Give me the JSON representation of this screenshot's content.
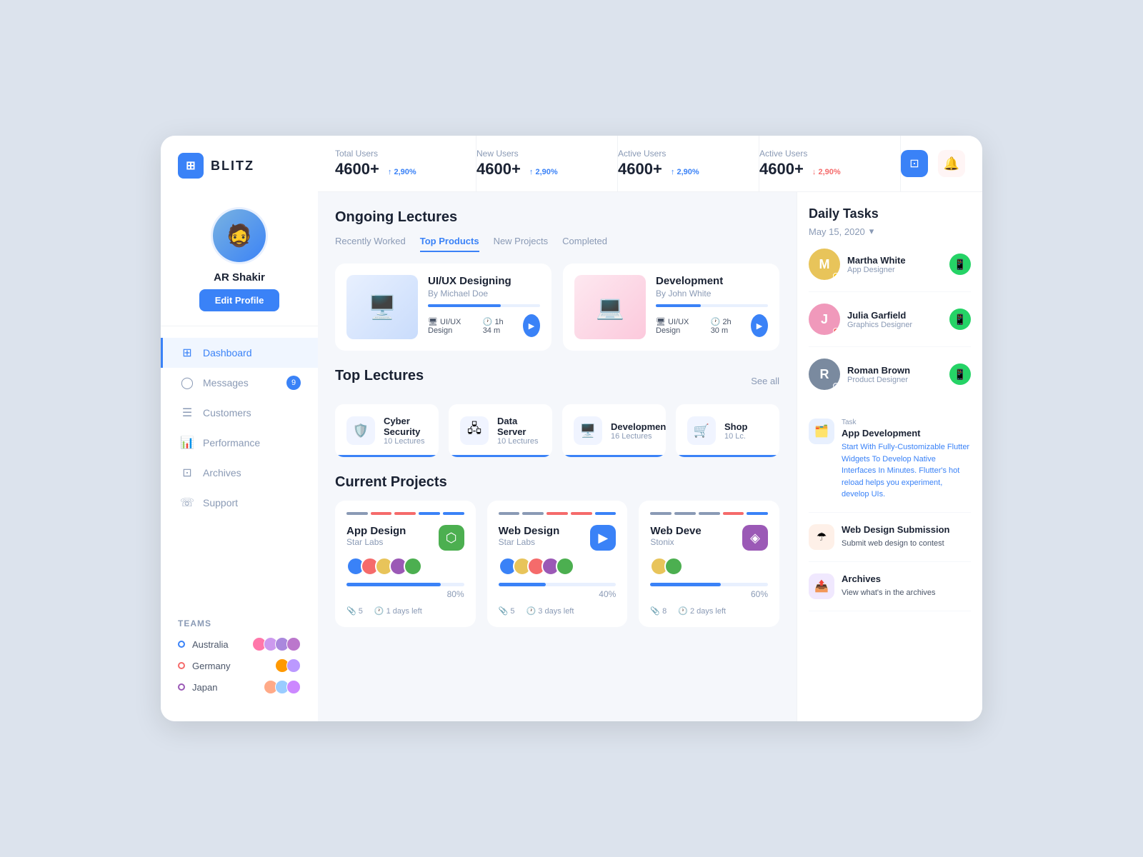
{
  "logo": {
    "icon": "⊞",
    "text": "BLITZ"
  },
  "profile": {
    "name": "AR Shakir",
    "edit_button": "Edit Profile",
    "avatar_emoji": "🧔"
  },
  "nav": {
    "items": [
      {
        "label": "Dashboard",
        "icon": "⊞",
        "active": true,
        "badge": null
      },
      {
        "label": "Messages",
        "icon": "◯",
        "active": false,
        "badge": "9"
      },
      {
        "label": "Customers",
        "icon": "☰",
        "active": false,
        "badge": null
      },
      {
        "label": "Performance",
        "icon": "📊",
        "active": false,
        "badge": null
      },
      {
        "label": "Archives",
        "icon": "⊡",
        "active": false,
        "badge": null
      },
      {
        "label": "Support",
        "icon": "☏",
        "active": false,
        "badge": null
      }
    ]
  },
  "teams": {
    "title": "Teams",
    "items": [
      {
        "name": "Australia",
        "dot_color": "#3a82f7",
        "avatars": [
          "#f7a",
          "#c9e",
          "#a8d",
          "#b7c"
        ]
      },
      {
        "name": "Germany",
        "dot_color": "#f56b6b",
        "avatars": [
          "#f90",
          "#b9f"
        ]
      },
      {
        "name": "Japan",
        "dot_color": "#9b59b6",
        "avatars": [
          "#fa8",
          "#9cf",
          "#c8f"
        ]
      }
    ]
  },
  "stats": [
    {
      "label": "Total Users",
      "value": "4600+",
      "trend": "↑ 2,90%",
      "trend_dir": "up"
    },
    {
      "label": "New Users",
      "value": "4600+",
      "trend": "↑ 2,90%",
      "trend_dir": "up"
    },
    {
      "label": "Active Users",
      "value": "4600+",
      "trend": "↑ 2,90%",
      "trend_dir": "up"
    },
    {
      "label": "Active Users",
      "value": "4600+",
      "trend": "↓ 2,90%",
      "trend_dir": "down"
    }
  ],
  "ongoing_lectures": {
    "title": "Ongoing Lectures",
    "tabs": [
      {
        "label": "Recently Worked",
        "active": false
      },
      {
        "label": "Top Products",
        "active": true
      },
      {
        "label": "New Projects",
        "active": false
      },
      {
        "label": "Completed",
        "active": false
      }
    ],
    "cards": [
      {
        "title": "UI/UX Designing",
        "by": "By Michael Doe",
        "tag": "UI/UX Design",
        "time": "1h 34 m",
        "progress": 65,
        "thumb_emoji": "🖥️",
        "thumb_bg": "blue"
      },
      {
        "title": "Development",
        "by": "By John White",
        "tag": "UI/UX Design",
        "time": "2h 30 m",
        "progress": 40,
        "thumb_emoji": "💻",
        "thumb_bg": "pink"
      }
    ]
  },
  "top_lectures": {
    "title": "Top Lectures",
    "see_all": "See all",
    "items": [
      {
        "name": "Cyber Security",
        "count": "10 Lectures",
        "icon": "🛡️"
      },
      {
        "name": "Data Server",
        "count": "10 Lectures",
        "icon": "🖧"
      },
      {
        "name": "Development",
        "count": "16 Lectures",
        "icon": "🖥️"
      },
      {
        "name": "Shop",
        "count": "10 Lc.",
        "icon": "🛒"
      }
    ]
  },
  "current_projects": {
    "title": "Current Projects",
    "items": [
      {
        "name": "App Design",
        "company": "Star Labs",
        "logo_emoji": "⬡",
        "logo_bg": "#4caf50",
        "color_bars": [
          "#8a9ab5",
          "#f56b6b",
          "#f56b6b",
          "#3a82f7",
          "#3a82f7"
        ],
        "progress": 80,
        "attachments": 5,
        "days_left": "1 days left",
        "avatar_colors": [
          "#3a82f7",
          "#f56b6b",
          "#e8c45a",
          "#9b59b6",
          "#4caf50"
        ]
      },
      {
        "name": "Web Design",
        "company": "Star Labs",
        "logo_emoji": "▶",
        "logo_bg": "#3a82f7",
        "color_bars": [
          "#8a9ab5",
          "#8a9ab5",
          "#f56b6b",
          "#f56b6b",
          "#3a82f7"
        ],
        "progress": 40,
        "attachments": 5,
        "days_left": "3 days left",
        "avatar_colors": [
          "#3a82f7",
          "#e8c45a",
          "#f56b6b",
          "#9b59b6",
          "#4caf50"
        ]
      },
      {
        "name": "Web Deve",
        "company": "Stonix",
        "logo_emoji": "◈",
        "logo_bg": "#9b59b6",
        "color_bars": [
          "#8a9ab5",
          "#8a9ab5",
          "#8a9ab5",
          "#f56b6b",
          "#3a82f7"
        ],
        "progress": 60,
        "attachments": 8,
        "days_left": "2 days left",
        "avatar_colors": [
          "#e8c45a",
          "#4caf50"
        ]
      }
    ]
  },
  "daily_tasks": {
    "title": "Daily Tasks",
    "date": "May 15, 2020",
    "contacts": [
      {
        "name": "Martha White",
        "role": "App Designer",
        "status_color": "#f5c518",
        "avatar_bg": "#e8c45a",
        "avatar_letter": "M"
      },
      {
        "name": "Julia Garfield",
        "role": "Graphics Designer",
        "status_color": "#f56b6b",
        "avatar_bg": "#f099bb",
        "avatar_letter": "J"
      },
      {
        "name": "Roman Brown",
        "role": "Product Designer",
        "status_color": "#8a9ab5",
        "avatar_bg": "#7a8a9f",
        "avatar_letter": "R"
      }
    ],
    "tasks": [
      {
        "category": "Task",
        "name": "App Development",
        "desc": "Start With Fully-Customizable Flutter Widgets To Develop Native Interfaces In Minutes. Flutter's hot reload helps you experiment, develop UIs.",
        "icon": "🗂️",
        "icon_bg": "blue"
      },
      {
        "category": "",
        "name": "Web Design Submission",
        "desc": "Submit web design to contest",
        "icon": "☂",
        "icon_bg": "orange"
      },
      {
        "category": "",
        "name": "Archives",
        "desc": "View what's in the archives",
        "icon": "📤",
        "icon_bg": "purple"
      }
    ]
  }
}
